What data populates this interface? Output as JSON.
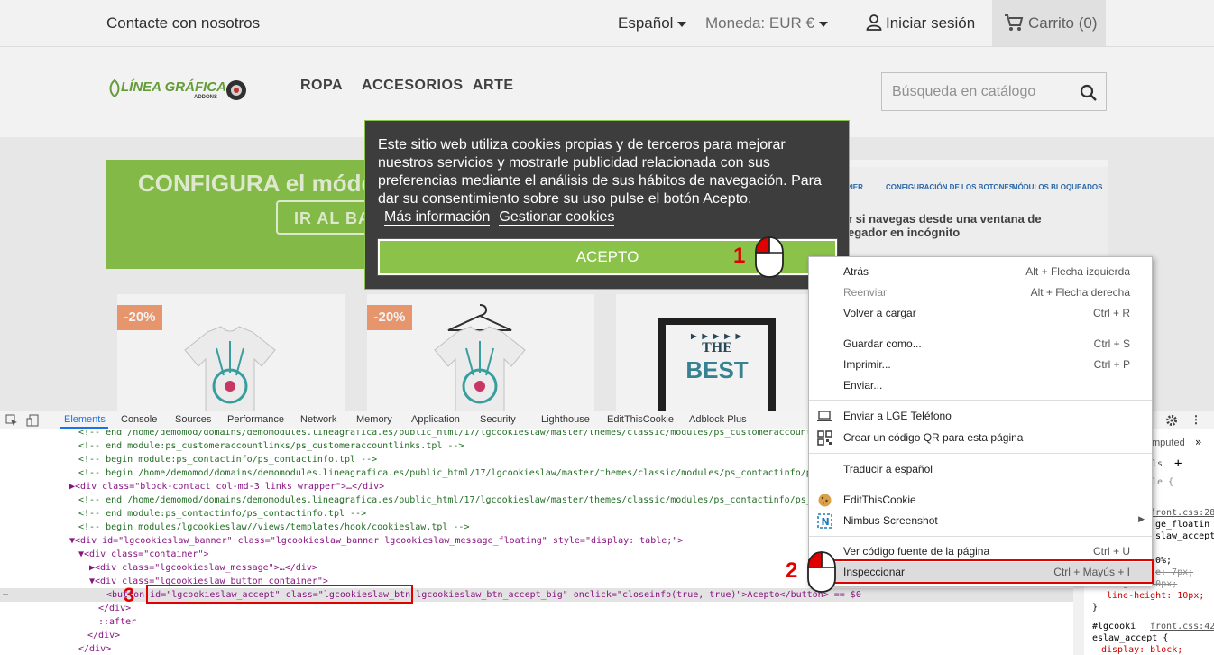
{
  "topbar": {
    "contact": "Contacte con nosotros",
    "language": "Español",
    "currency": "Moneda: EUR €",
    "login": "Iniciar sesión",
    "cart": "Carrito (0)"
  },
  "header": {
    "logo_main": "LÍNEA GRÁFICA",
    "logo_sub": "ADDONS",
    "nav": [
      "ROPA",
      "ACCESORIOS",
      "ARTE"
    ],
    "search_placeholder": "Búsqueda en catálogo"
  },
  "banner": {
    "promo_title": "CONFIGURA el móde",
    "promo_button": "IR AL BA",
    "tabs": [
      "NER",
      "CONFIGURACIÓN DE LOS BOTONES",
      "MÓDULOS BLOQUEADOS"
    ],
    "text_line1": "r si navegas desde una ventana de",
    "text_line2_a": "egador en ",
    "text_line2_b": "incógnito"
  },
  "products": {
    "discount1": "-20%",
    "discount2": "-20%",
    "poster_line1": "▶ ▶ ▶ ▶ ▶",
    "poster_line2": "THE",
    "poster_line3": "BEST"
  },
  "cookie": {
    "message": "Este sitio web utiliza cookies propias y de terceros para mejorar nuestros servicios y mostrarle publicidad relacionada con sus preferencias mediante el análisis de sus hábitos de navegación. Para dar su consentimiento sobre su uso pulse el botón Acepto.",
    "more_info": "Más información",
    "manage": "Gestionar cookies",
    "accept": "ACEPTO"
  },
  "devtools": {
    "tabs": [
      "Elements",
      "Console",
      "Sources",
      "Performance",
      "Network",
      "Memory",
      "Application",
      "Security",
      "Lighthouse",
      "EditThisCookie",
      "Adblock Plus"
    ],
    "code": [
      "<!-- end /home/demomod/domains/demomodules.lineagrafica.es/public_html/17/lgcookieslaw/master/themes/classic/modules/ps_customeraccountli",
      "<!-- end module:ps_customeraccountlinks/ps_customeraccountlinks.tpl -->",
      "<!-- begin module:ps_contactinfo/ps_contactinfo.tpl -->",
      "<!-- begin /home/demomod/domains/demomodules.lineagrafica.es/public_html/17/lgcookieslaw/master/themes/classic/modules/ps_contactinfo/ps_",
      "▶<div class=\"block-contact col-md-3 links wrapper\">…</div>",
      "<!-- end /home/demomod/domains/demomodules.lineagrafica.es/public_html/17/lgcookieslaw/master/themes/classic/modules/ps_contactinfo/ps_co",
      "<!-- end module:ps_contactinfo/ps_contactinfo.tpl -->",
      "<!-- begin modules/lgcookieslaw//views/templates/hook/cookieslaw.tpl -->",
      "▼<div id=\"lgcookieslaw_banner\" class=\"lgcookieslaw_banner  lgcookieslaw_message_floating\" style=\"display: table;\">",
      "▼<div class=\"container\">",
      "▶<div class=\"lgcookieslaw_message\">…</div>",
      "▼<div class=\"lgcookieslaw_button_container\">",
      "<button id=\"lgcookieslaw_accept\" class=\"lgcookieslaw_btn lgcookieslaw_btn_accept_big\" onclick=\"closeinfo(true, true)\">Acepto</button> == $0",
      "</div>",
      "::after",
      "</div>",
      "</div>"
    ],
    "styles": {
      "computed": "mputed",
      "filter": "ls",
      "brace": "le {",
      "file1": "front.css:289",
      "sel1a": "ge_floatin",
      "sel1b": "slaw_accept",
      "p1": "0%;",
      "p2": "e: 7px;",
      "p3": "height: 30px;",
      "p4": "line-height: 10px;",
      "close": "}",
      "sel2a": "#lgcooki",
      "file2": "front.css:42",
      "sel2b": "eslaw_accept {",
      "p5": "display: block;"
    }
  },
  "context_menu": {
    "items": [
      {
        "label": "Atrás",
        "shortcut": "Alt + Flecha izquierda"
      },
      {
        "label": "Reenviar",
        "shortcut": "Alt + Flecha derecha"
      },
      {
        "label": "Volver a cargar",
        "shortcut": "Ctrl + R"
      },
      {
        "label": "Guardar como...",
        "shortcut": "Ctrl + S"
      },
      {
        "label": "Imprimir...",
        "shortcut": "Ctrl + P"
      },
      {
        "label": "Enviar...",
        "shortcut": ""
      },
      {
        "label": "Enviar a LGE Teléfono",
        "shortcut": ""
      },
      {
        "label": "Crear un código QR para esta página",
        "shortcut": ""
      },
      {
        "label": "Traducir a español",
        "shortcut": ""
      },
      {
        "label": "EditThisCookie",
        "shortcut": ""
      },
      {
        "label": "Nimbus Screenshot",
        "shortcut": "▶"
      },
      {
        "label": "Ver código fuente de la página",
        "shortcut": "Ctrl + U"
      },
      {
        "label": "Inspeccionar",
        "shortcut": "Ctrl + Mayús + I"
      }
    ]
  },
  "annotations": {
    "n1": "1",
    "n2": "2",
    "n3": "3"
  },
  "colors": {
    "accent_green": "#8bc34a",
    "banner_dark": "#3d3d3d",
    "highlight_red": "#e00000"
  }
}
